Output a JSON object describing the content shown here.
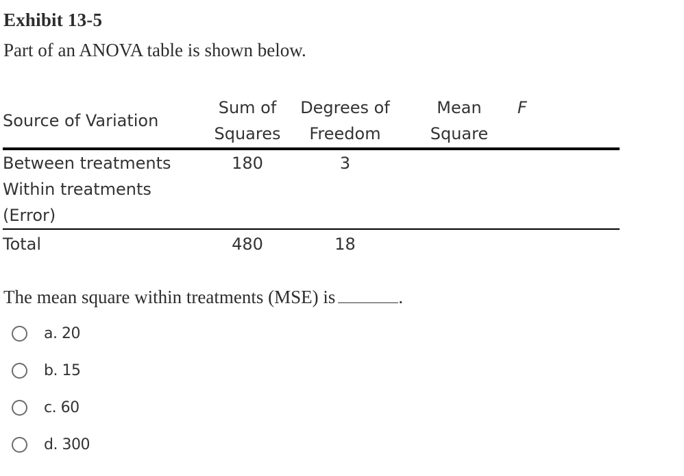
{
  "exhibit": {
    "title": "Exhibit 13-5",
    "intro": "Part of an ANOVA table is shown below."
  },
  "table": {
    "headers": [
      {
        "line1": "Source of Variation",
        "line2": ""
      },
      {
        "line1": "Sum of",
        "line2": "Squares"
      },
      {
        "line1": "Degrees of",
        "line2": "Freedom"
      },
      {
        "line1": "Mean",
        "line2": "Square"
      },
      {
        "line1": "F",
        "line2": ""
      }
    ],
    "rows": [
      {
        "source": "Between treatments",
        "ss": "180",
        "df": "3",
        "ms": "",
        "f": ""
      },
      {
        "source": "Within treatments (Error)",
        "ss": "",
        "df": "",
        "ms": "",
        "f": ""
      },
      {
        "source": "Total",
        "ss": "480",
        "df": "18",
        "ms": "",
        "f": ""
      }
    ]
  },
  "question": {
    "text": "The mean square within treatments (MSE) is",
    "end": "."
  },
  "options": [
    {
      "label": "a. 20",
      "selected": false
    },
    {
      "label": "b. 15",
      "selected": false
    },
    {
      "label": "c. 60",
      "selected": false
    },
    {
      "label": "d. 300",
      "selected": false
    }
  ]
}
